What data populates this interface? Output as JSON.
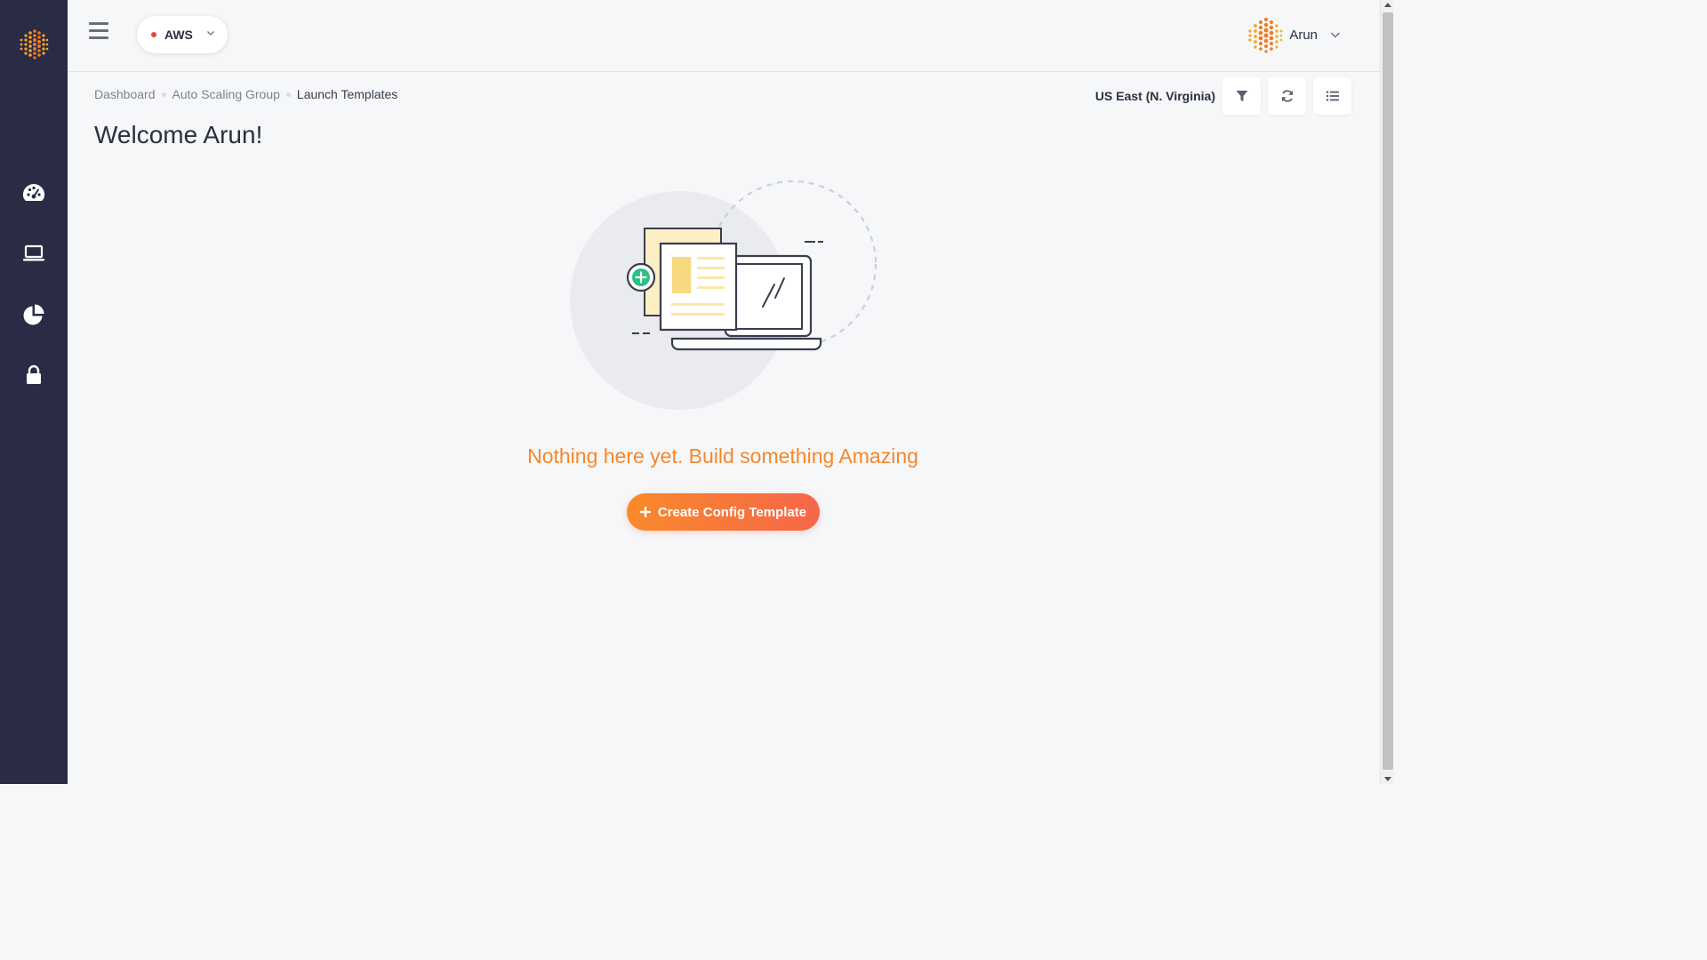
{
  "sidebar": {
    "logo_icon": "brand-dots-logo",
    "items": [
      {
        "name": "dashboard",
        "icon": "speedometer-icon"
      },
      {
        "name": "instances",
        "icon": "laptop-icon"
      },
      {
        "name": "reports",
        "icon": "pie-chart-icon"
      },
      {
        "name": "security",
        "icon": "lock-icon"
      }
    ]
  },
  "header": {
    "menu_icon": "hamburger-menu-icon",
    "cloud_provider": "AWS",
    "cloud_status_color": "#e8433a",
    "user_name": "Arun"
  },
  "breadcrumb": [
    "Dashboard",
    "Auto Scaling Group",
    "Launch Templates"
  ],
  "page_title": "Welcome Arun!",
  "toolbar": {
    "region": "US East (N. Virginia)",
    "buttons": [
      "filter-icon",
      "refresh-icon",
      "list-view-icon"
    ]
  },
  "empty_state": {
    "message": "Nothing here yet. Build something Amazing",
    "button_label": "Create Config Template",
    "illustration": "documents-and-laptop-illustration"
  },
  "colors": {
    "sidebar_bg": "#2a2b45",
    "accent_orange": "#f7872a",
    "button_gradient_start": "#f98a2a",
    "button_gradient_end": "#f5664a",
    "plus_badge_green": "#2dbf86"
  }
}
